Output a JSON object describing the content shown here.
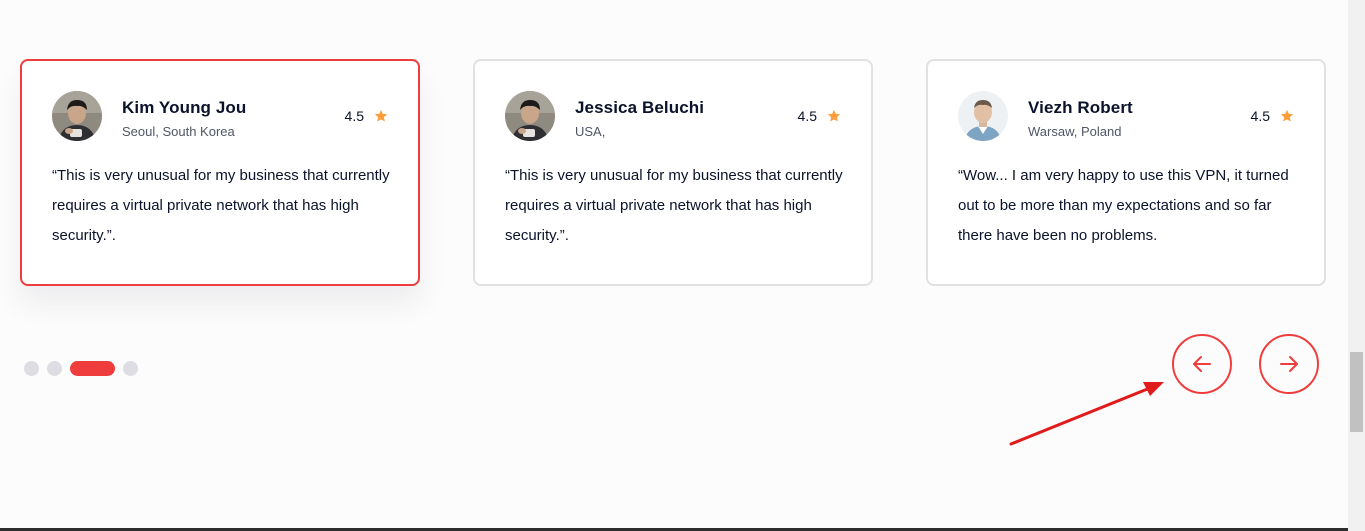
{
  "testimonials": [
    {
      "name": "Kim Young Jou",
      "location": "Seoul, South Korea",
      "rating": "4.5",
      "avatar": "man-portrait-dark-hair",
      "quote": "“This is very unusual for my business that currently requires a virtual private network that has high security.”."
    },
    {
      "name": "Jessica Beluchi",
      "location": "USA,",
      "rating": "4.5",
      "avatar": "man-portrait-dark-hair",
      "quote": "“This is very unusual for my business that currently requires a virtual private network that has high security.”."
    },
    {
      "name": "Viezh Robert",
      "location": "Warsaw, Poland",
      "rating": "4.5",
      "avatar": "man-portrait-short-hair",
      "quote": "“Wow... I am very happy to use this VPN, it turned out to be more than my expectations and so far there have been no problems."
    }
  ],
  "pagination": {
    "count": 4,
    "active_index": 2
  },
  "navigation": {
    "prev_icon": "arrow-left-icon",
    "next_icon": "arrow-right-icon"
  },
  "colors": {
    "accent": "#ef3d3d",
    "star": "#fe9d3a",
    "text_dark": "#0b132a",
    "text_muted": "#4f5665",
    "card_border": "#e1e1e4",
    "dot_inactive": "#dddde3",
    "annotation_arrow": "#e11b1b"
  }
}
